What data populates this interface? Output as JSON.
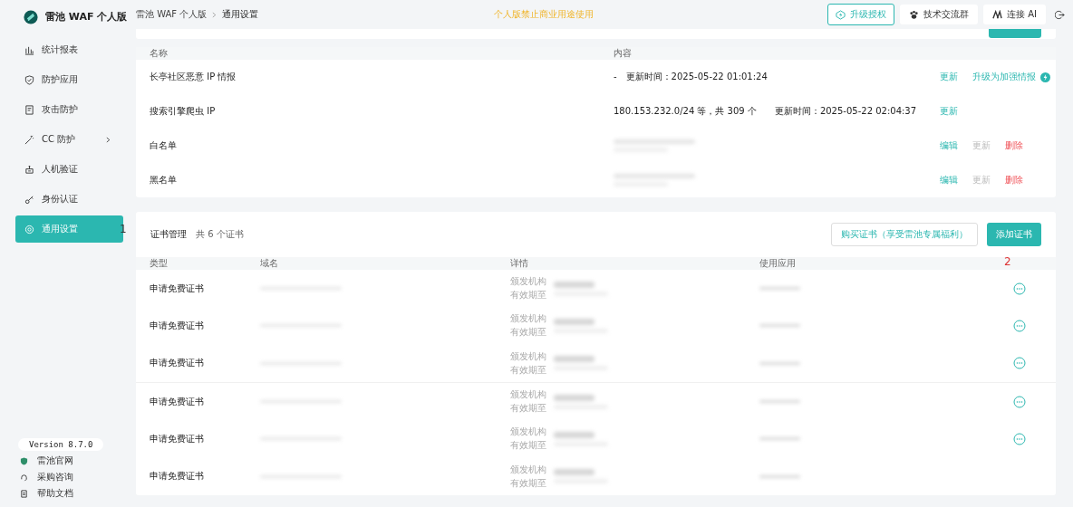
{
  "app": {
    "name": "雷池 WAF 个人版"
  },
  "breadcrumb": [
    "雷池 WAF 个人版",
    "通用设置"
  ],
  "notice": "个人版禁止商业用途使用",
  "header_actions": [
    {
      "label": "升级授权",
      "kind": "upgrade"
    },
    {
      "label": "技术交流群",
      "kind": "group"
    },
    {
      "label": "连接 AI",
      "kind": "ai"
    },
    {
      "kind": "logout"
    }
  ],
  "sidebar": {
    "items": [
      {
        "label": "统计报表",
        "selected": false,
        "submenu": false
      },
      {
        "label": "防护应用",
        "selected": false,
        "submenu": false
      },
      {
        "label": "攻击防护",
        "selected": false,
        "submenu": false
      },
      {
        "label": "CC 防护",
        "selected": false,
        "submenu": true
      },
      {
        "label": "人机验证",
        "selected": false,
        "submenu": false
      },
      {
        "label": "身份认证",
        "selected": false,
        "submenu": false
      },
      {
        "label": "通用设置",
        "selected": true,
        "submenu": false,
        "annotation": "1"
      }
    ],
    "version": "Version 8.7.0",
    "links": [
      {
        "label": "雷池官网"
      },
      {
        "label": "采购咨询"
      },
      {
        "label": "帮助文档"
      }
    ]
  },
  "rules_table": {
    "columns": [
      "名称",
      "内容"
    ],
    "rows": [
      {
        "name": "长亭社区恶意 IP 情报",
        "content": "-　更新时间：2025-05-22 01:01:24",
        "redacted": false,
        "actions": [
          {
            "label": "更新",
            "kind": "primary"
          },
          {
            "label": "升级为加强情报",
            "kind": "upgrade"
          }
        ]
      },
      {
        "name": "搜索引擎爬虫 IP",
        "content": "180.153.232.0/24 等，共 309 个　　更新时间：2025-05-22 02:04:37",
        "redacted": false,
        "actions": [
          {
            "label": "更新",
            "kind": "primary"
          }
        ]
      },
      {
        "name": "白名单",
        "redacted": true,
        "actions": [
          {
            "label": "编辑",
            "kind": "primary"
          },
          {
            "label": "更新",
            "kind": "disabled"
          },
          {
            "label": "删除",
            "kind": "danger"
          }
        ]
      },
      {
        "name": "黑名单",
        "redacted": true,
        "actions": [
          {
            "label": "编辑",
            "kind": "primary"
          },
          {
            "label": "更新",
            "kind": "disabled"
          },
          {
            "label": "删除",
            "kind": "danger"
          }
        ]
      }
    ]
  },
  "certificates": {
    "title": "证书管理",
    "count": "共 6 个证书",
    "buy_button": "购买证书（享受雷池专属福利）",
    "add_button": "添加证书",
    "columns": [
      "类型",
      "域名",
      "详情",
      "使用应用"
    ],
    "annotation": "2",
    "rows": [
      {
        "type": "申请免费证书",
        "detail_labels": [
          "颁发机构",
          "有效期至"
        ],
        "more_button": true
      },
      {
        "type": "申请免费证书",
        "detail_labels": [
          "颁发机构",
          "有效期至"
        ],
        "more_button": true
      },
      {
        "type": "申请免费证书",
        "detail_labels": [
          "颁发机构",
          "有效期至"
        ],
        "more_button": true
      },
      {
        "type": "申请免费证书",
        "detail_labels": [
          "颁发机构",
          "有效期至"
        ],
        "more_button": true
      },
      {
        "type": "申请免费证书",
        "detail_labels": [
          "颁发机构",
          "有效期至"
        ],
        "more_button": true
      },
      {
        "type": "申请免费证书",
        "detail_labels": [
          "颁发机构",
          "有效期至"
        ],
        "more_button": false
      }
    ]
  }
}
